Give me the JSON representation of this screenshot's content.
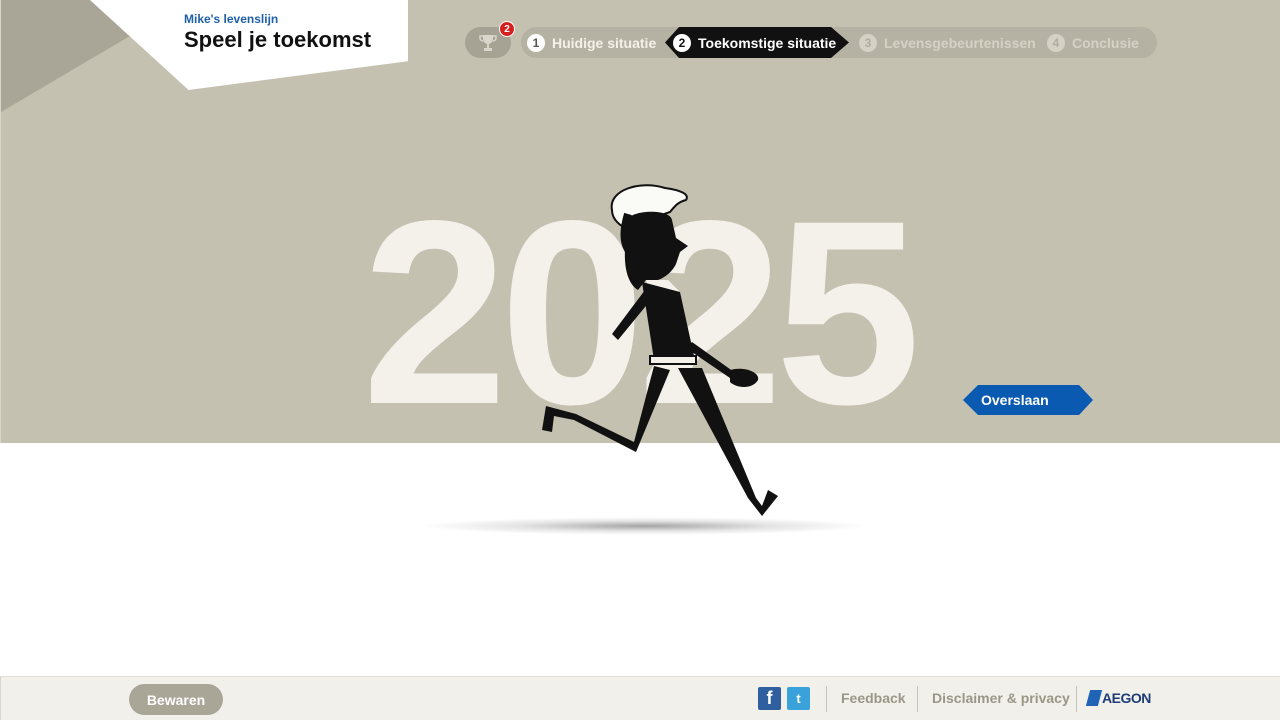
{
  "header": {
    "subtitle": "Mike's levenslijn",
    "title": "Speel je toekomst"
  },
  "achievements": {
    "icon": "trophy-icon",
    "badge_count": "2"
  },
  "steps": [
    {
      "num": "1",
      "label": "Huidige situatie",
      "state": "done"
    },
    {
      "num": "2",
      "label": "Toekomstige situatie",
      "state": "active"
    },
    {
      "num": "3",
      "label": "Levensgebeurtenissen",
      "state": "upcoming"
    },
    {
      "num": "4",
      "label": "Conclusie",
      "state": "upcoming"
    }
  ],
  "scene": {
    "year": "2025",
    "skip_label": "Overslaan"
  },
  "footer": {
    "save_label": "Bewaren",
    "facebook_glyph": "f",
    "twitter_glyph": "t",
    "feedback_label": "Feedback",
    "disclaimer_label": "Disclaimer & privacy",
    "brand": "AEGON"
  },
  "colors": {
    "stage_bg": "#c5c1b1",
    "accent_blue": "#0b5ab1",
    "active_step": "#111111",
    "badge_red": "#d42020"
  }
}
